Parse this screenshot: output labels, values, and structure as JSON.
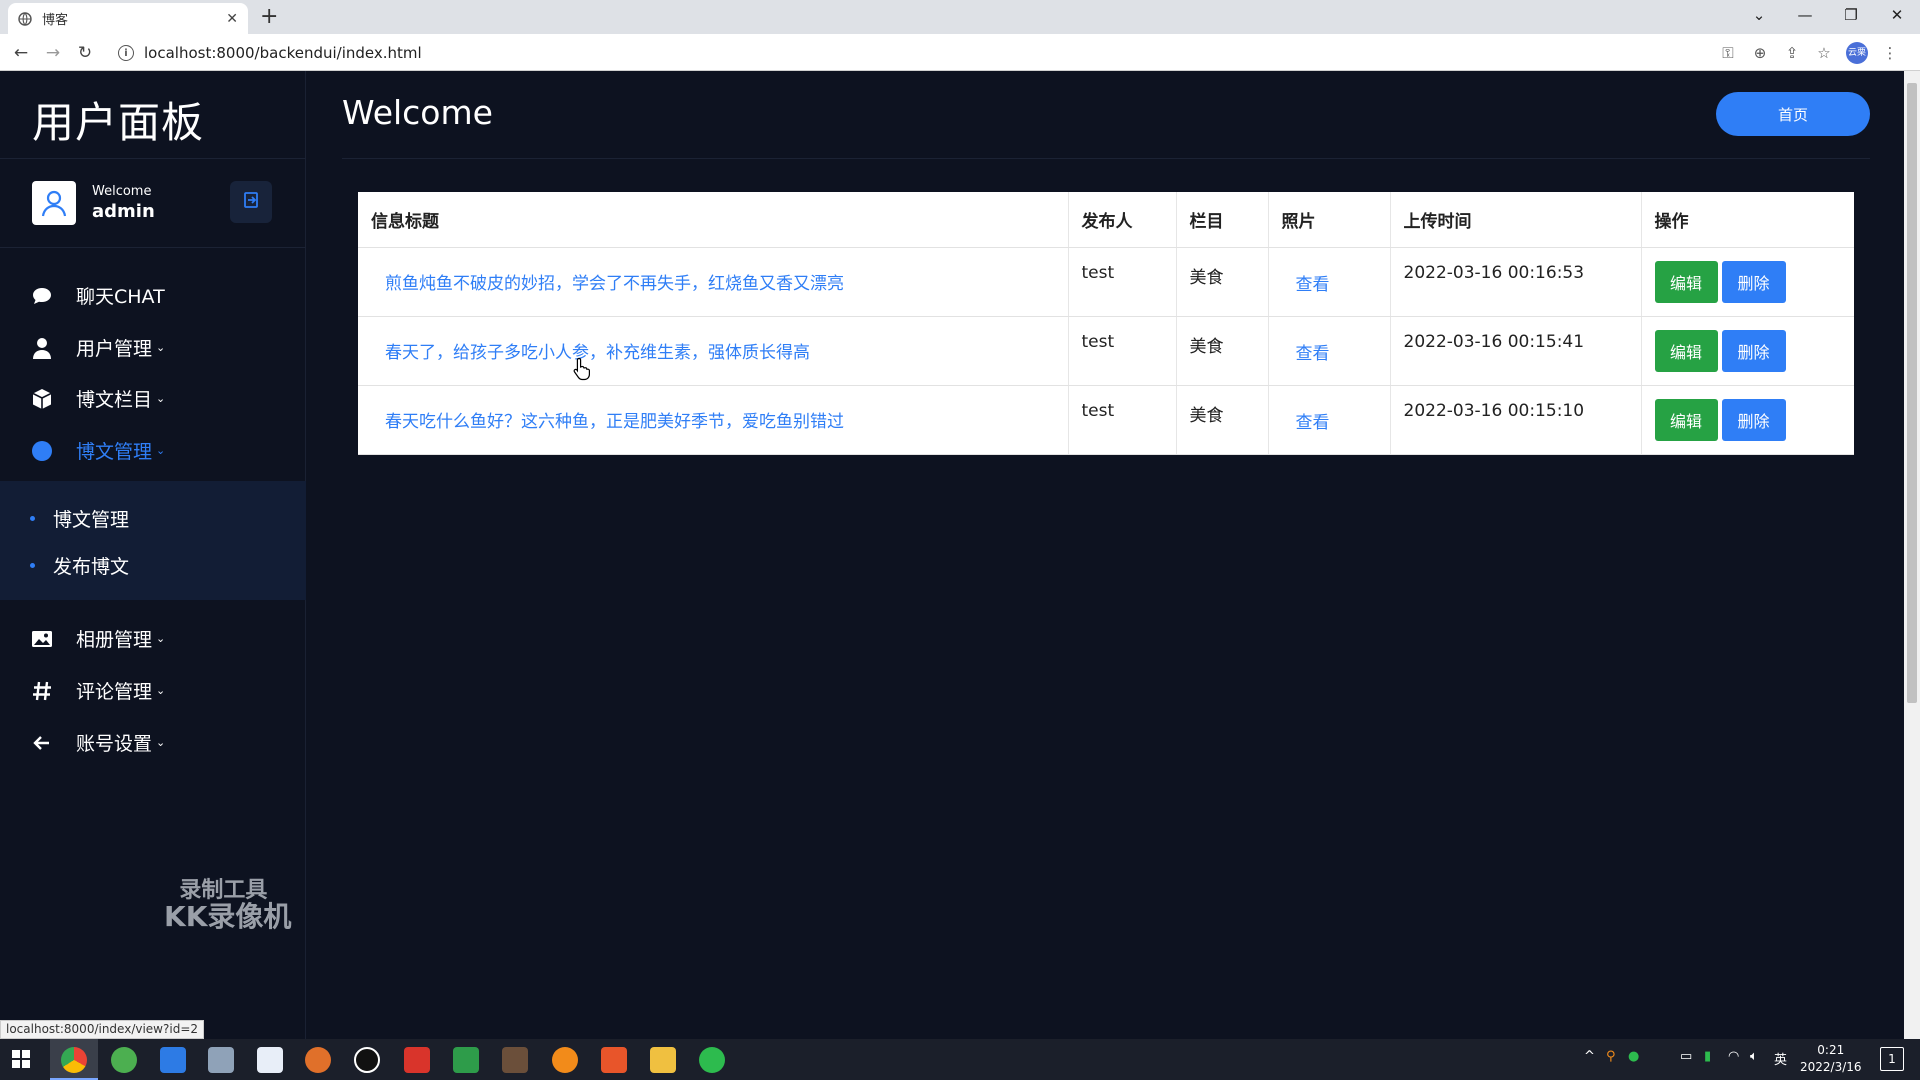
{
  "browser": {
    "tab_title": "博客",
    "url": "localhost:8000/backendui/index.html",
    "status_url": "localhost:8000/index/view?id=2",
    "profile_label": "云栗"
  },
  "sidebar": {
    "brand": "用户面板",
    "user": {
      "welcome": "Welcome",
      "name": "admin"
    },
    "menu": [
      {
        "label": "聊天CHAT",
        "icon": "chat-bubble-icon"
      },
      {
        "label": "用户管理",
        "icon": "user-icon",
        "caret": "⌄"
      },
      {
        "label": "博文栏目",
        "icon": "box-icon",
        "caret": "⌄"
      },
      {
        "label": "博文管理",
        "icon": "circle-icon",
        "caret": "⌄"
      },
      {
        "label": "相册管理",
        "icon": "image-icon",
        "caret": "⌄"
      },
      {
        "label": "评论管理",
        "icon": "hash-icon",
        "caret": "⌄"
      },
      {
        "label": "账号设置",
        "icon": "arrow-left-icon",
        "caret": "⌄"
      }
    ],
    "submenu": [
      {
        "label": "博文管理"
      },
      {
        "label": "发布博文"
      }
    ]
  },
  "watermark": {
    "line1": "录制工具",
    "line2": "KK录像机"
  },
  "main": {
    "title": "Welcome",
    "home_button": "首页",
    "table": {
      "headers": [
        "信息标题",
        "发布人",
        "栏目",
        "照片",
        "上传时间",
        "操作"
      ],
      "rows": [
        {
          "title": "煎鱼炖鱼不破皮的妙招，学会了不再失手，红烧鱼又香又漂亮",
          "author": "test",
          "category": "美食",
          "photo": "查看",
          "time": "2022-03-16 00:16:53",
          "edit": "编辑",
          "delete": "删除"
        },
        {
          "title": "春天了，给孩子多吃小人参，补充维生素，强体质长得高",
          "author": "test",
          "category": "美食",
          "photo": "查看",
          "time": "2022-03-16 00:15:41",
          "edit": "编辑",
          "delete": "删除"
        },
        {
          "title": "春天吃什么鱼好？这六种鱼，正是肥美好季节，爱吃鱼别错过",
          "author": "test",
          "category": "美食",
          "photo": "查看",
          "time": "2022-03-16 00:15:10",
          "edit": "编辑",
          "delete": "删除"
        }
      ]
    }
  },
  "taskbar": {
    "ime": "英",
    "time": "0:21",
    "date": "2022/3/16",
    "notification_count": "1"
  },
  "colors": {
    "accent": "#2f7ef6",
    "edit_green": "#26a244",
    "page_bg": "#0d1220",
    "submenu_bg": "#121d35"
  }
}
